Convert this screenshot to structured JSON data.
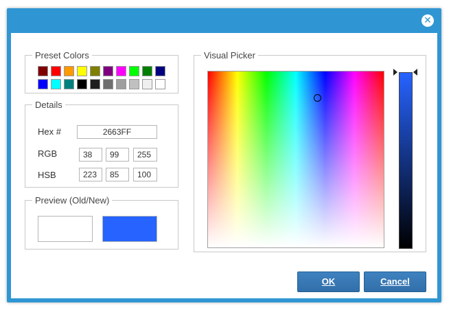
{
  "dialog": {
    "close_icon": "close-icon"
  },
  "preset": {
    "legend": "Preset Colors",
    "row1": [
      "#7f0000",
      "#ff0000",
      "#ff9900",
      "#ffff00",
      "#7f7f00",
      "#7f007f",
      "#ff00ff",
      "#00ff00",
      "#007f00",
      "#00007f"
    ],
    "row2": [
      "#0000ff",
      "#00ffff",
      "#007f7f",
      "#000000",
      "#1f1f1f",
      "#6f6f6f",
      "#9f9f9f",
      "#c0c0c0",
      "#efefef",
      "#ffffff"
    ]
  },
  "details": {
    "legend": "Details",
    "hex_label": "Hex #",
    "hex_value": "2663FF",
    "rgb_label": "RGB",
    "r": "38",
    "g": "99",
    "b": "255",
    "hsb_label": "HSB",
    "h": "223",
    "s": "85",
    "v": "100"
  },
  "preview": {
    "legend": "Preview (Old/New)",
    "old_color": "#ffffff",
    "new_color": "#2663ff"
  },
  "picker": {
    "legend": "Visual Picker"
  },
  "buttons": {
    "ok": "OK",
    "cancel": "Cancel"
  }
}
